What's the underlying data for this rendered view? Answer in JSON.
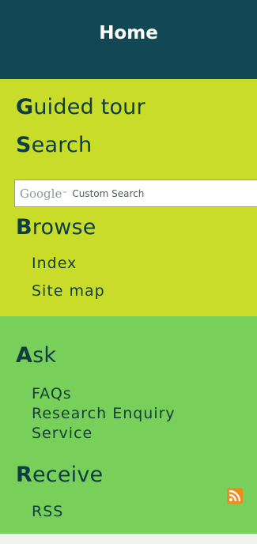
{
  "header": {
    "title": "Home"
  },
  "nav": {
    "guided_tour": {
      "cap": "G",
      "rest": "uided tour"
    },
    "search": {
      "cap": "S",
      "rest": "earch"
    },
    "search_box": {
      "logo": "Google",
      "tm": "™",
      "label": "Custom Search"
    },
    "browse": {
      "cap": "B",
      "rest": "rowse"
    },
    "browse_links": [
      "Index",
      "Site map"
    ],
    "ask": {
      "cap": "A",
      "rest": "sk"
    },
    "ask_links": [
      "FAQs",
      "Research Enquiry",
      "Service"
    ],
    "receive": {
      "cap": "R",
      "rest": "eceive"
    },
    "receive_links": [
      "RSS"
    ]
  },
  "icons": {
    "rss": "rss-feed-icon"
  },
  "colors": {
    "header_bg": "#114853",
    "lime_bg": "#c9dc29",
    "green_bg": "#78cf5a",
    "rss_orange": "#f08a1c"
  }
}
